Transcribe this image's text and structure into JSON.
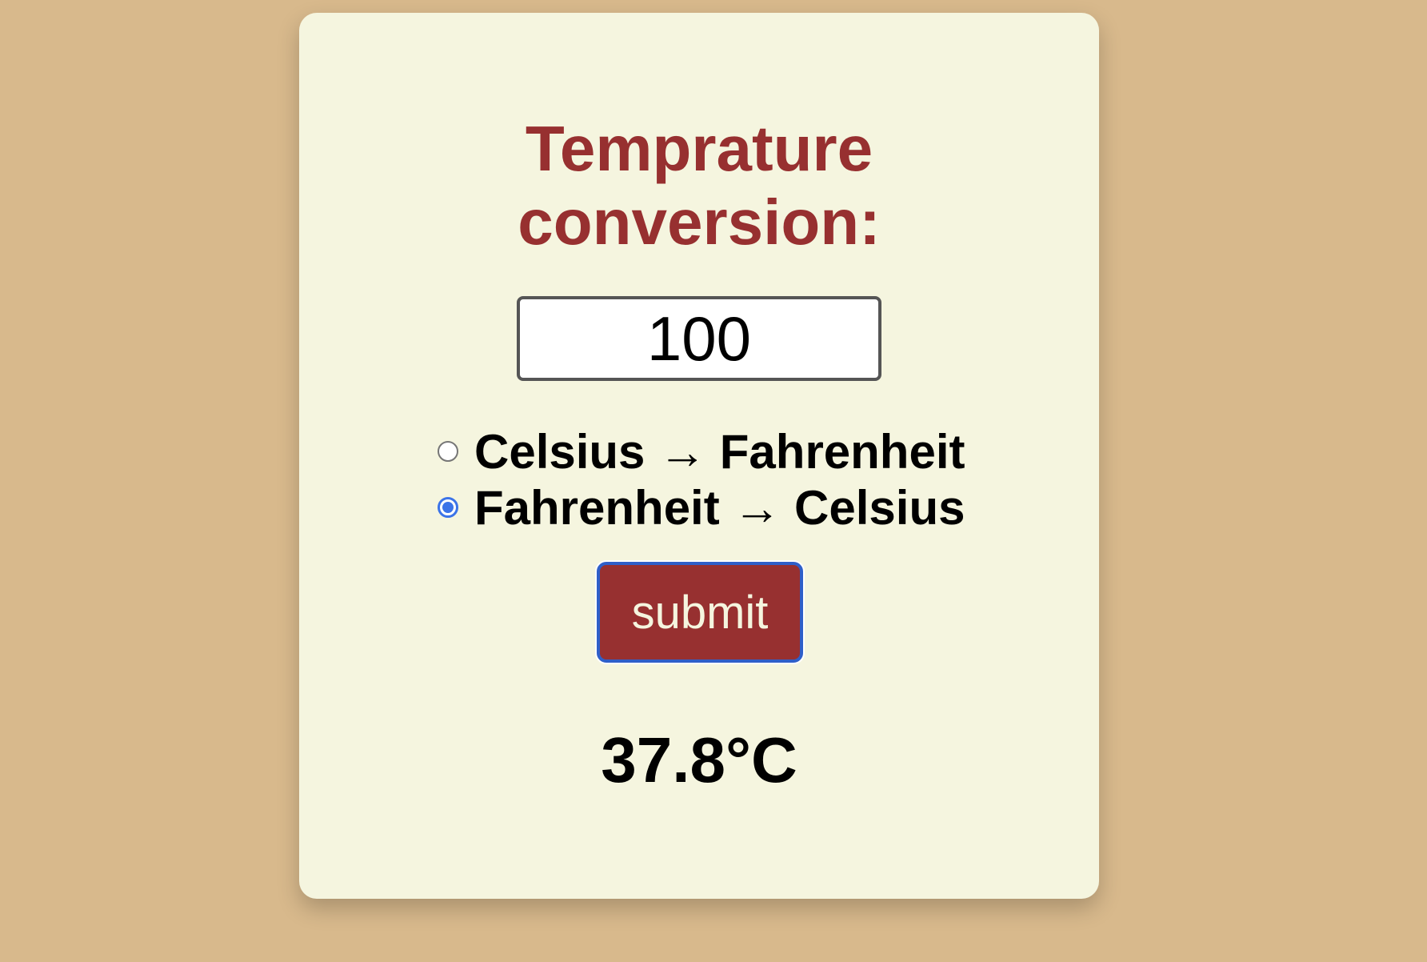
{
  "colors": {
    "background": "#d8b98c",
    "card": "#f5f5df",
    "accent": "#973030",
    "radio_selected": "#3b73e8"
  },
  "converter": {
    "title_line1": "Temprature",
    "title_line2": "conversion:",
    "input_value": "100",
    "options": [
      {
        "label": "Celsius → Fahrenheit",
        "selected": false
      },
      {
        "label": "Fahrenheit → Celsius",
        "selected": true
      }
    ],
    "submit_label": "submit",
    "result": "37.8°C"
  }
}
